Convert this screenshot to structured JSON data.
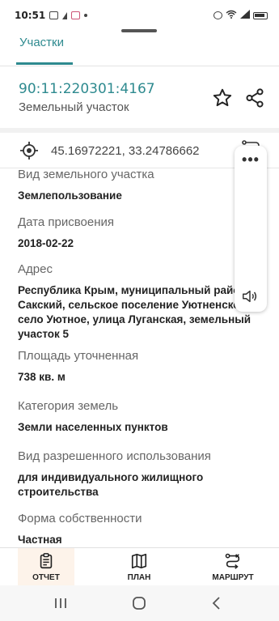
{
  "status_bar": {
    "time": "10:51"
  },
  "tabs": [
    {
      "label": "Участки",
      "active": true
    }
  ],
  "parcel": {
    "cadastral_number": "90:11:220301:4167",
    "type": "Земельный участок",
    "favorite_icon": "star-outline-icon",
    "share_icon": "share-icon"
  },
  "coordinates": {
    "text": "45.16972221, 33.24786662"
  },
  "fields": [
    {
      "label": "Вид земельного участка",
      "value": "Землепользование"
    },
    {
      "label": "Дата присвоения",
      "value": "2018-02-22"
    },
    {
      "label": "Адрес",
      "value": "Республика Крым, муниципальный район\nСакский, сельское поселение Уютненское\nсело Уютное, улица Луганская, земельный\nучасток 5"
    },
    {
      "label": "Площадь уточненная",
      "value": "738 кв. м"
    },
    {
      "label": "Категория земель",
      "value": "Земли населенных пунктов"
    },
    {
      "label": "Вид разрешенного использования",
      "value": "для индивидуального жилищного\nстроительства"
    },
    {
      "label": "Форма собственности",
      "value": "Частная"
    }
  ],
  "bottom_nav": {
    "report": "ОТЧЕТ",
    "plan": "ПЛАН",
    "route": "МАРШРУТ"
  },
  "colors": {
    "accent": "#2e8a8f",
    "active_tab_bg": "#fdf3ea"
  }
}
